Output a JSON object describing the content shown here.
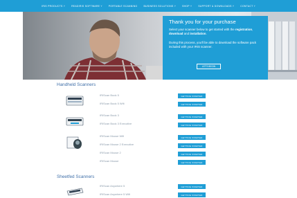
{
  "nav": {
    "items": [
      "IRIS PRODUCTS ˅",
      "READIRIS SOFTWARE ˅",
      "PORTABLE SCANNING",
      "BUSINESS SOLUTIONS ˅",
      "SHOP ˅",
      "SUPPORT & DOWNLOADS ˅",
      "CONTACT ˅"
    ]
  },
  "hero": {
    "title": "Thank you for your purchase",
    "para1_a": "Select your scanner below to get started with the ",
    "para1_b1": "registration",
    "para1_c": ", ",
    "para1_b2": "download",
    "para1_d": " and ",
    "para1_b3": "installation",
    "para1_e": ".",
    "para2": "During this process, you'll be able to download the software pack included with your IRIS scanner.",
    "button": "LET'S BEGIN"
  },
  "handheld": {
    "title": "Handheld Scanners",
    "products": [
      "IRIScan Book 5",
      "IRIScan Book 5 Wifi",
      "IRIScan Book 3",
      "IRIScan Book 3 Executive",
      "IRIScan Mouse Wifi",
      "IRIScan Mouse 2 Executive",
      "IRIScan Mouse 2",
      "IRIScan Mouse"
    ]
  },
  "sheetfed": {
    "title": "Sheetfed Scanners",
    "products": [
      "IRIScan Anywhere 5",
      "IRIScan Anywhere 5 Wifi"
    ]
  },
  "button_label": "GETTING STARTED",
  "colors": {
    "accent": "#1f9ed6",
    "heading": "#3f6fa8",
    "product_text": "#8a9aaa"
  }
}
